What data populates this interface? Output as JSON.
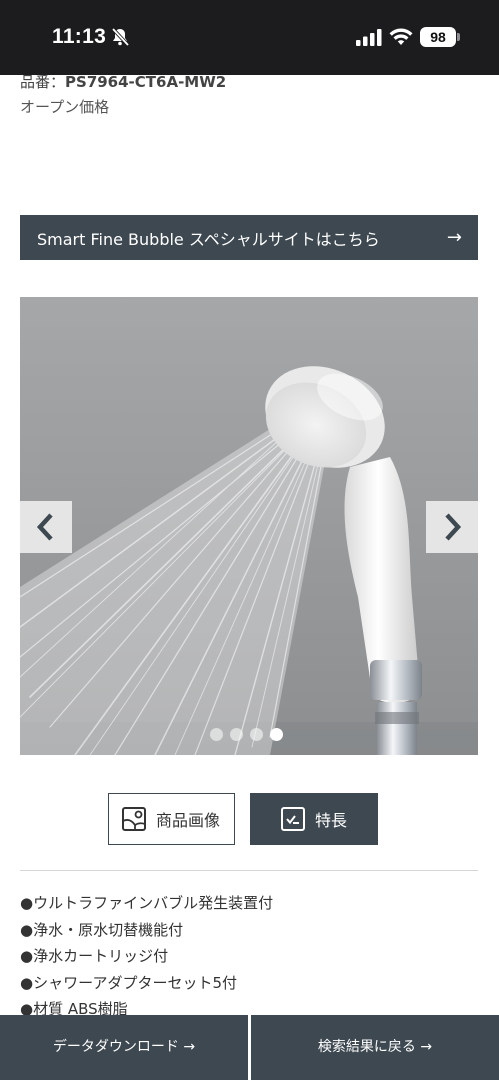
{
  "status_bar": {
    "time": "11:13",
    "battery": "98"
  },
  "product": {
    "code_label": "品番：",
    "code_value": "PS7964-CT6A-MW2",
    "price": "オープン価格"
  },
  "special_banner": {
    "label": "Smart Fine Bubble スペシャルサイトはこちら",
    "arrow": "→"
  },
  "carousel": {
    "prev_icon": "chevron-left-icon",
    "next_icon": "chevron-right-icon",
    "slide_count": 4,
    "active_index": 3
  },
  "tabs": [
    {
      "label": "商品画像",
      "icon": "image-icon",
      "selected": false
    },
    {
      "label": "特長",
      "icon": "checklist-icon",
      "selected": true
    }
  ],
  "features": [
    "●ウルトラファインバブル発生装置付",
    "●浄水・原水切替機能付",
    "●浄水カートリッジ付",
    "●シャワーアダプターセット5付",
    "●材質 ABS樹脂"
  ],
  "bottom_bar": {
    "download": "データダウンロード →",
    "back": "検索結果に戻る →"
  },
  "colors": {
    "dark_accent": "#3d4850",
    "status_bar": "#1c1c1e"
  }
}
